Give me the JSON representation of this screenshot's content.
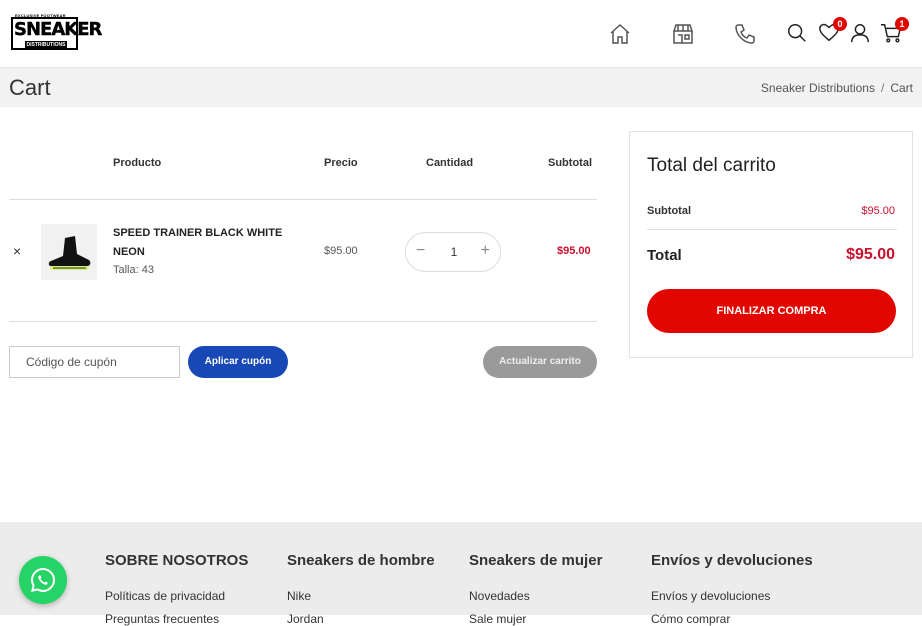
{
  "brand": {
    "logo_top": "EXCLUSIVE FOOTWEAR",
    "logo_main": "SNEAKER",
    "logo_bottom": "DISTRIBUTIONS",
    "accent": "#e10600",
    "blue": "#1748b5"
  },
  "header": {
    "nav_icons": [
      "home-icon",
      "store-icon",
      "phone-icon"
    ],
    "wishlist_count": "0",
    "cart_count": "1"
  },
  "page": {
    "title": "Cart",
    "breadcrumb": [
      "Sneaker Distributions",
      "Cart"
    ],
    "breadcrumb_sep": "/"
  },
  "table": {
    "headers": {
      "product": "Producto",
      "price": "Precio",
      "quantity": "Cantidad",
      "subtotal": "Subtotal"
    },
    "rows": [
      {
        "remove": "×",
        "name": "SPEED TRAINER BLACK WHITE NEON",
        "size": "Talla: 43",
        "price": "$95.00",
        "quantity": "1",
        "subtotal": "$95.00"
      }
    ]
  },
  "coupon": {
    "placeholder": "Código de cupón",
    "apply_label": "Aplicar cupón",
    "update_label": "Actualizar carrito"
  },
  "totals": {
    "title": "Total del carrito",
    "subtotal_label": "Subtotal",
    "subtotal_value": "$95.00",
    "total_label": "Total",
    "total_value": "$95.00",
    "checkout_label": "FINALIZAR COMPRA"
  },
  "footer": {
    "columns": [
      {
        "heading": "SOBRE NOSOTROS",
        "links": [
          "Políticas de privacidad",
          "Preguntas frecuentes"
        ]
      },
      {
        "heading": "Sneakers de hombre",
        "links": [
          "Nike",
          "Jordan"
        ]
      },
      {
        "heading": "Sneakers de mujer",
        "links": [
          "Novedades",
          "Sale mujer"
        ]
      },
      {
        "heading": "Envíos y devoluciones",
        "links": [
          "Envíos y devoluciones",
          "Cómo comprar"
        ]
      }
    ]
  }
}
